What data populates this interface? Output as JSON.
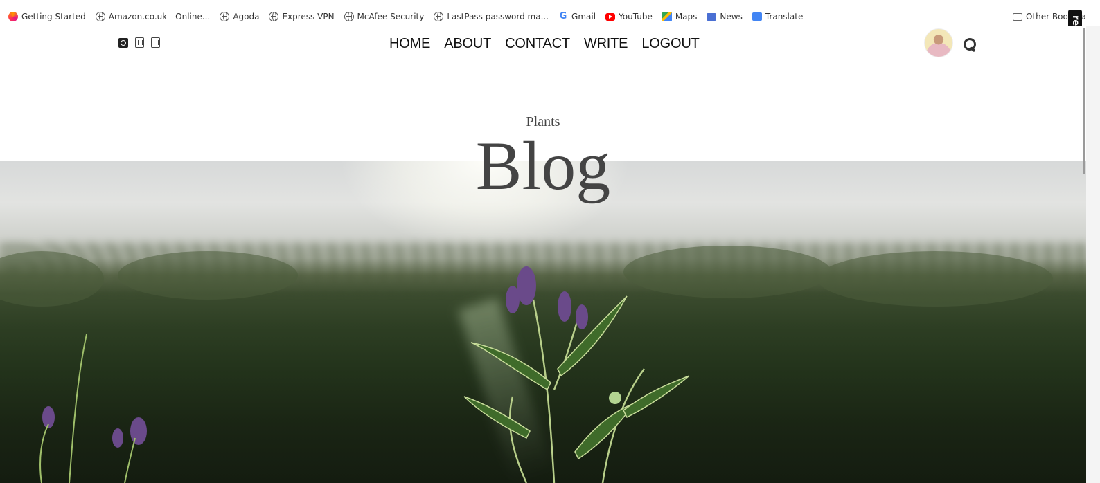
{
  "bookmarks": {
    "items": [
      {
        "label": "Getting Started",
        "icon": "firefox-icon"
      },
      {
        "label": "Amazon.co.uk - Online...",
        "icon": "globe-icon"
      },
      {
        "label": "Agoda",
        "icon": "globe-icon"
      },
      {
        "label": "Express VPN",
        "icon": "globe-icon"
      },
      {
        "label": "McAfee Security",
        "icon": "globe-icon"
      },
      {
        "label": "LastPass password ma...",
        "icon": "globe-icon"
      },
      {
        "label": "Gmail",
        "icon": "google-icon"
      },
      {
        "label": "YouTube",
        "icon": "youtube-icon"
      },
      {
        "label": "Maps",
        "icon": "maps-icon"
      },
      {
        "label": "News",
        "icon": "news-icon"
      },
      {
        "label": "Translate",
        "icon": "translate-icon"
      }
    ],
    "other_label": "Other Bookma",
    "rec_label": "rec"
  },
  "nav": {
    "links": [
      "HOME",
      "ABOUT",
      "CONTACT",
      "WRITE",
      "LOGOUT"
    ]
  },
  "header": {
    "subtitle": "Plants",
    "title": "Blog"
  },
  "icons": {
    "social": [
      "instagram-icon",
      "social-icon",
      "social-icon"
    ],
    "search": "search-icon"
  },
  "colors": {
    "title_text": "#444444",
    "nav_text": "#111111"
  }
}
